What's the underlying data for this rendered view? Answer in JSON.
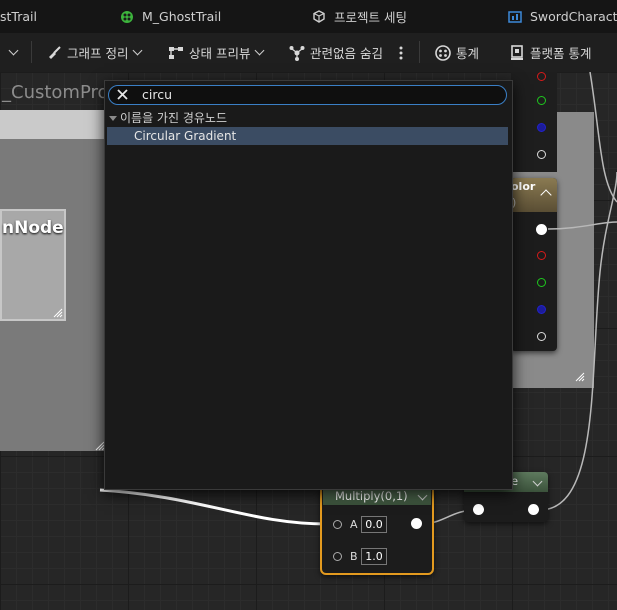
{
  "tabs": [
    {
      "label": "stTrail",
      "icon": "material-icon"
    },
    {
      "label": "M_GhostTrail",
      "icon": "material-sphere-icon"
    },
    {
      "label": "프로젝트 세팅",
      "icon": "settings-cubes-icon"
    },
    {
      "label": "SwordCharacte",
      "icon": "blueprint-icon"
    }
  ],
  "toolbar": {
    "graph_cleanup_label": "그래프 정리",
    "state_preview_label": "상태 프리뷰",
    "hide_unrelated_label": "관련없음 숨김",
    "stats_label": "통계",
    "platform_stats_label": "플랫폼 통계"
  },
  "graph": {
    "comment_title": "_CustomPro",
    "inner_node_title": "nNode",
    "color_node_title": "olor",
    "color_node_sub": ")",
    "multiply_node": {
      "title": "Multiply(0,1)",
      "a_label": "A",
      "a_value": "0.0",
      "b_label": "B",
      "b_value": "1.0"
    },
    "right_node_title": "e"
  },
  "popup": {
    "search_value": "circu",
    "category_label": "이름을 가진 경유노드",
    "results": [
      "Circular Gradient"
    ]
  },
  "colors": {
    "search_border": "#3a7fc6",
    "selected_row": "#3b4c63",
    "multiply_border": "#e39a1f",
    "pin_red": "#d61a1a",
    "pin_green": "#1ec81e",
    "pin_blue": "#2222cc"
  }
}
